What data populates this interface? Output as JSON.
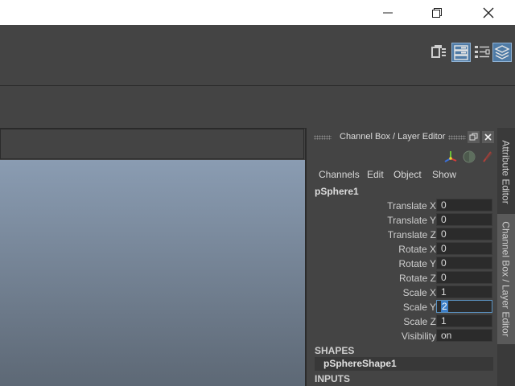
{
  "window": {
    "minimize_icon": "minimize-icon",
    "restore_icon": "restore-icon",
    "close_icon": "close-icon"
  },
  "toolbar": {
    "icons": [
      "modeling-toolkit-icon",
      "attribute-editor-icon",
      "tool-settings-icon",
      "channel-box-layer-editor-icon"
    ]
  },
  "channel_box": {
    "title": "Channel Box / Layer Editor",
    "menus": [
      "Channels",
      "Edit",
      "Object",
      "Show"
    ],
    "object_name": "pSphere1",
    "attributes": [
      {
        "label": "Translate X",
        "value": "0"
      },
      {
        "label": "Translate Y",
        "value": "0"
      },
      {
        "label": "Translate Z",
        "value": "0"
      },
      {
        "label": "Rotate X",
        "value": "0"
      },
      {
        "label": "Rotate Y",
        "value": "0"
      },
      {
        "label": "Rotate Z",
        "value": "0"
      },
      {
        "label": "Scale X",
        "value": "1"
      },
      {
        "label": "Scale Y",
        "value": "2"
      },
      {
        "label": "Scale Z",
        "value": "1"
      },
      {
        "label": "Visibility",
        "value": "on"
      }
    ],
    "shapes_header": "SHAPES",
    "shape_name": "pSphereShape1",
    "inputs_header": "INPUTS"
  },
  "side_tabs": {
    "attribute_editor": "Attribute Editor",
    "channel_box": "Channel Box / Layer Editor"
  },
  "colors": {
    "accent": "#5a91c0",
    "panel_bg": "#444444",
    "viewport_top": "#8a9cb2"
  }
}
